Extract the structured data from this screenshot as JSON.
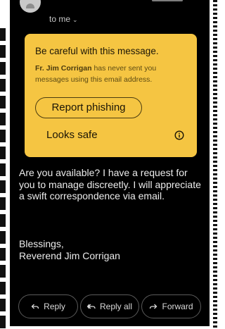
{
  "header": {
    "recipient_label": "to me",
    "recipient_chevron": "chevron-down-icon"
  },
  "warning": {
    "title": "Be careful with this message.",
    "sender_name": "Fr. Jim Corrigan",
    "description_suffix": " has never sent you messages using this email address.",
    "report_button_label": "Report phishing",
    "looks_safe_label": "Looks safe",
    "info_icon": "info-icon",
    "card_color": "#f5c542"
  },
  "message": {
    "body": "Are you available? I have a request for you to manage discreetly. I will appreciate a swift correspondence via email.",
    "closing": "Blessings,",
    "signature": "Reverend Jim Corrigan"
  },
  "actions": {
    "reply_label": "Reply",
    "reply_icon": "reply-icon",
    "reply_all_label": "Reply all",
    "reply_all_icon": "reply-all-icon",
    "forward_label": "Forward",
    "forward_icon": "forward-icon"
  }
}
